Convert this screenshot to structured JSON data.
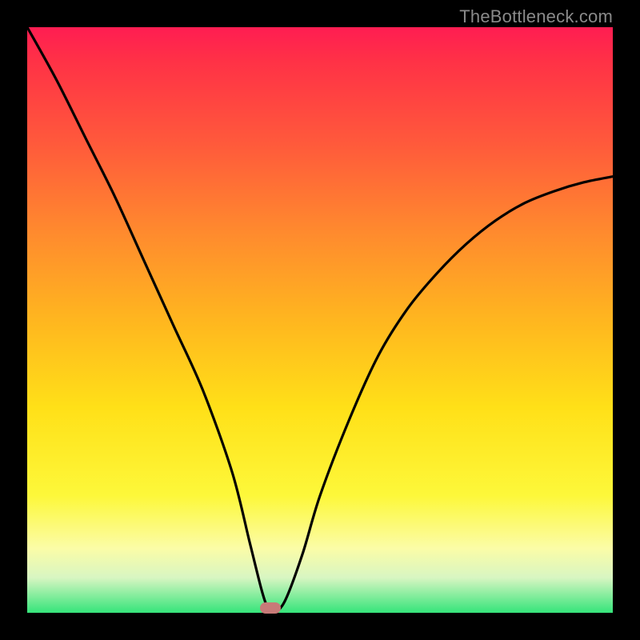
{
  "watermark": "TheBottleneck.com",
  "chart_data": {
    "type": "line",
    "title": "",
    "xlabel": "",
    "ylabel": "",
    "xlim": [
      0,
      100
    ],
    "ylim": [
      0,
      100
    ],
    "grid": false,
    "series": [
      {
        "name": "curve",
        "x": [
          0,
          5,
          10,
          15,
          20,
          25,
          30,
          35,
          38,
          40,
          41,
          42,
          44,
          47,
          50,
          55,
          60,
          65,
          70,
          75,
          80,
          85,
          90,
          95,
          100
        ],
        "values": [
          100,
          91,
          81,
          71,
          60,
          49,
          38,
          24,
          12,
          4,
          1,
          0,
          2,
          10,
          20,
          33,
          44,
          52,
          58,
          63,
          67,
          70,
          72,
          73.5,
          74.5
        ]
      }
    ],
    "marker": {
      "x": 41.5,
      "y": 0.8,
      "color": "#c87a78"
    },
    "colors": {
      "curve": "#000000",
      "gradient_top": "#ff1d52",
      "gradient_bottom": "#35e47a",
      "background": "#000000"
    }
  }
}
